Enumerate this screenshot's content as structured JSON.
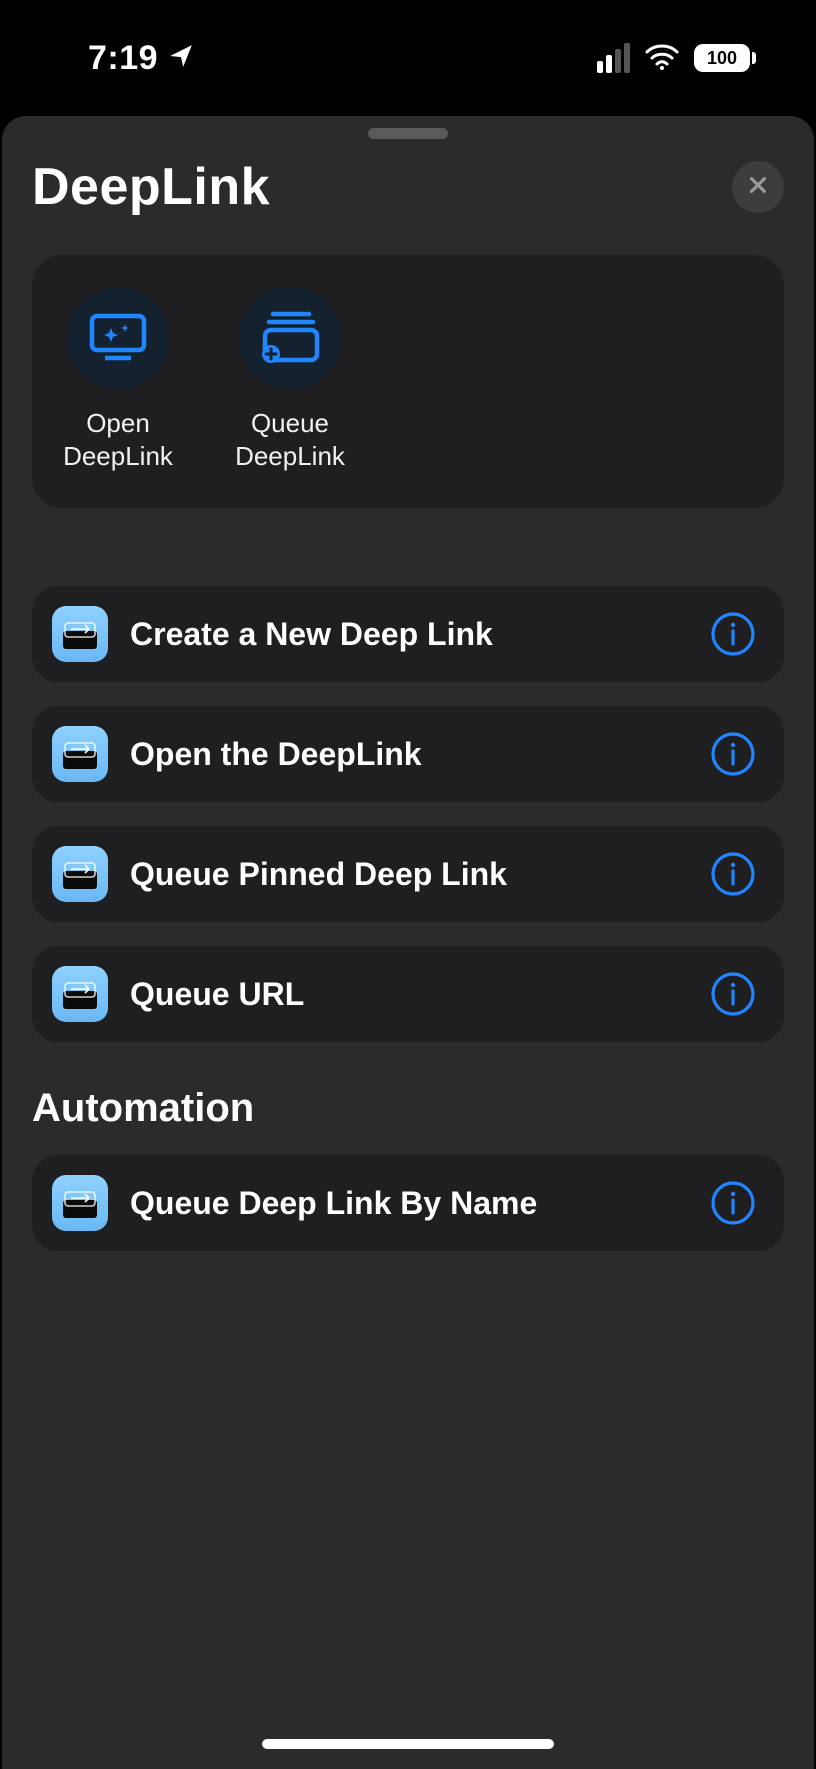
{
  "status": {
    "time": "7:19",
    "battery": "100"
  },
  "sheet": {
    "title": "DeepLink"
  },
  "topActions": [
    {
      "label": "Open\nDeepLink",
      "icon": "screen-sparkle-icon"
    },
    {
      "label": "Queue\nDeepLink",
      "icon": "stack-plus-icon"
    }
  ],
  "shortcuts": [
    {
      "label": "Create a New Deep Link"
    },
    {
      "label": "Open the DeepLink"
    },
    {
      "label": "Queue Pinned Deep Link"
    },
    {
      "label": "Queue URL"
    }
  ],
  "sections": [
    {
      "title": "Automation",
      "items": [
        {
          "label": "Queue Deep Link By Name"
        }
      ]
    }
  ]
}
